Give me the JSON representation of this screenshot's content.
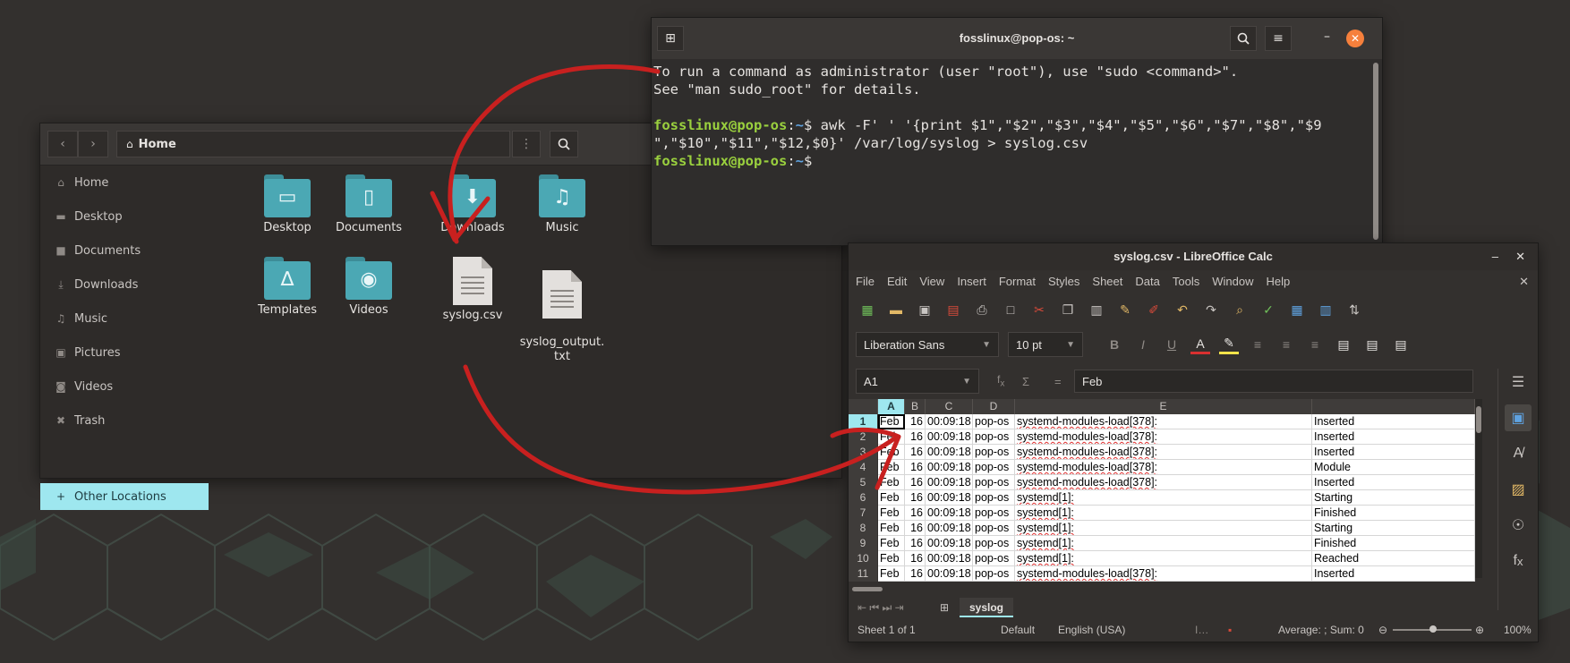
{
  "file_manager": {
    "path_label": "Home",
    "sidebar": [
      {
        "label": "Home",
        "icon": "home-icon"
      },
      {
        "label": "Desktop",
        "icon": "desktop-icon"
      },
      {
        "label": "Documents",
        "icon": "documents-icon"
      },
      {
        "label": "Downloads",
        "icon": "downloads-icon"
      },
      {
        "label": "Music",
        "icon": "music-icon"
      },
      {
        "label": "Pictures",
        "icon": "pictures-icon"
      },
      {
        "label": "Videos",
        "icon": "videos-icon"
      },
      {
        "label": "Trash",
        "icon": "trash-icon"
      }
    ],
    "other_locations": "Other Locations",
    "items": [
      {
        "label": "Desktop",
        "icon": "folder-desktop-icon"
      },
      {
        "label": "Documents",
        "icon": "folder-documents-icon"
      },
      {
        "label": "Downloads",
        "icon": "folder-downloads-icon"
      },
      {
        "label": "Music",
        "icon": "folder-music-icon"
      },
      {
        "label": "Templates",
        "icon": "folder-templates-icon"
      },
      {
        "label": "Videos",
        "icon": "folder-videos-icon"
      },
      {
        "label": "syslog.csv",
        "icon": "text-file-icon"
      },
      {
        "label": "syslog_output.\ntxt",
        "icon": "text-file-icon"
      }
    ]
  },
  "terminal": {
    "title": "fosslinux@pop-os: ~",
    "line1": "To run a command as administrator (user \"root\"), use \"sudo <command>\".",
    "line2": "See \"man sudo_root\" for details.",
    "prompt_user": "fosslinux@pop-os",
    "prompt_sep": ":",
    "prompt_path": "~",
    "prompt_dollar": "$ ",
    "command_a": "awk -F' ' '{print $1\",\"$2\",\"$3\",\"$4\",\"$5\",\"$6\",\"$7\",\"$8\",\"$9",
    "command_b": "\",\"$10\",\"$11\",\"$12,$0}' /var/log/syslog > syslog.csv"
  },
  "calc": {
    "title": "syslog.csv - LibreOffice Calc",
    "menu": [
      "File",
      "Edit",
      "View",
      "Insert",
      "Format",
      "Styles",
      "Sheet",
      "Data",
      "Tools",
      "Window",
      "Help"
    ],
    "font_name": "Liberation Sans",
    "font_size": "10 pt",
    "cell_ref": "A1",
    "formula_value": "Feb",
    "columns": [
      "A",
      "B",
      "C",
      "D",
      "E"
    ],
    "rows": [
      [
        "1",
        "Feb",
        "16",
        "00:09:18",
        "pop-os",
        "systemd-modules-load[378]:",
        "Inserted"
      ],
      [
        "2",
        "Feb",
        "16",
        "00:09:18",
        "pop-os",
        "systemd-modules-load[378]:",
        "Inserted"
      ],
      [
        "3",
        "Feb",
        "16",
        "00:09:18",
        "pop-os",
        "systemd-modules-load[378]:",
        "Inserted"
      ],
      [
        "4",
        "Feb",
        "16",
        "00:09:18",
        "pop-os",
        "systemd-modules-load[378]:",
        "Module"
      ],
      [
        "5",
        "Feb",
        "16",
        "00:09:18",
        "pop-os",
        "systemd-modules-load[378]:",
        "Inserted"
      ],
      [
        "6",
        "Feb",
        "16",
        "00:09:18",
        "pop-os",
        "systemd[1]:",
        "Starting"
      ],
      [
        "7",
        "Feb",
        "16",
        "00:09:18",
        "pop-os",
        "systemd[1]:",
        "Finished"
      ],
      [
        "8",
        "Feb",
        "16",
        "00:09:18",
        "pop-os",
        "systemd[1]:",
        "Starting"
      ],
      [
        "9",
        "Feb",
        "16",
        "00:09:18",
        "pop-os",
        "systemd[1]:",
        "Finished"
      ],
      [
        "10",
        "Feb",
        "16",
        "00:09:18",
        "pop-os",
        "systemd[1]:",
        "Reached"
      ],
      [
        "11",
        "Feb",
        "16",
        "00:09:18",
        "pop-os",
        "systemd-modules-load[378]:",
        "Inserted"
      ]
    ],
    "sheet_tab": "syslog",
    "status": {
      "sheet": "Sheet 1 of 1",
      "style": "Default",
      "language": "English (USA)",
      "summary": "Average: ; Sum: 0",
      "zoom": "100%"
    }
  },
  "colors": {
    "accent": "#9ee7ef",
    "annotation": "#c8201f",
    "folder": "#4ba8b4"
  }
}
